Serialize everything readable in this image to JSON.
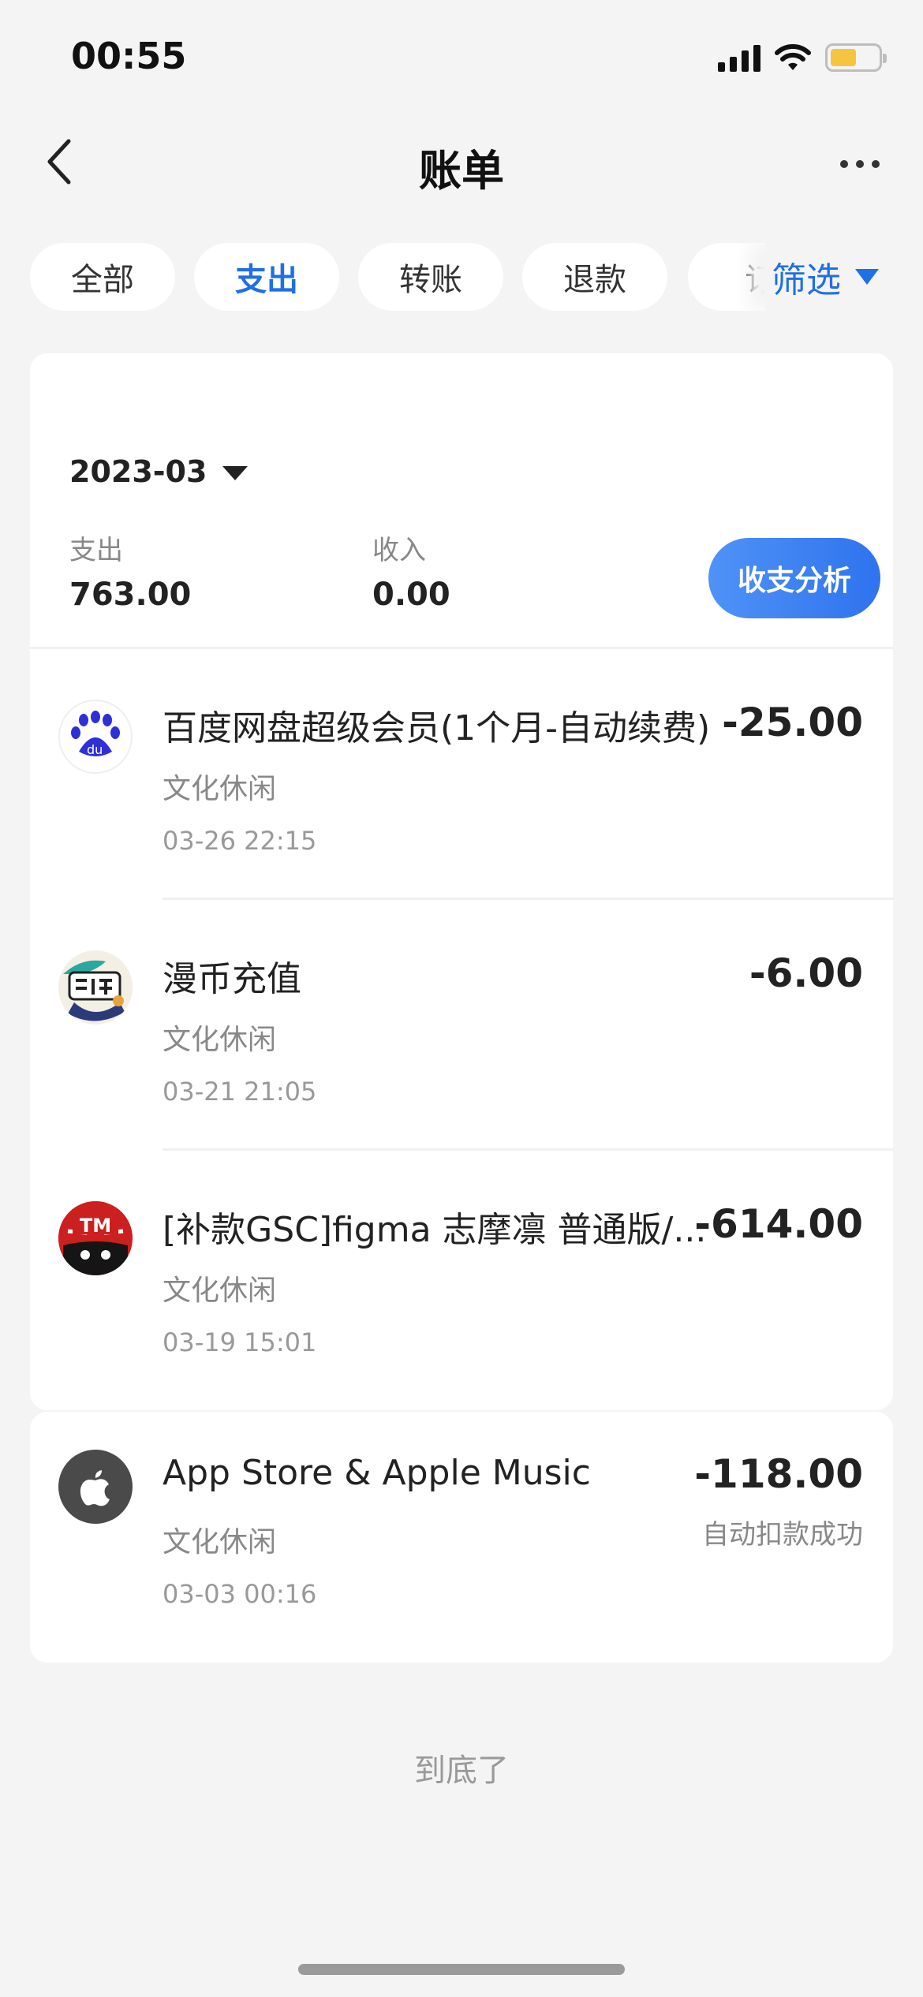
{
  "status_bar": {
    "time": "00:55"
  },
  "nav": {
    "title": "账单"
  },
  "tabs": [
    "全部",
    "支出",
    "转账",
    "退款",
    "订"
  ],
  "active_tab": 1,
  "filter": {
    "label": "筛选"
  },
  "summary": {
    "month": "2023-03",
    "expense_label": "支出",
    "expense_value": "763.00",
    "income_label": "收入",
    "income_value": "0.00",
    "analysis_button": "收支分析"
  },
  "transactions": [
    {
      "title": "百度网盘超级会员(1个月-自动续费)",
      "category": "文化休闲",
      "time": "03-26 22:15",
      "amount": "-25.00",
      "icon": "baidu-netdisk-logo"
    },
    {
      "title": "漫币充值",
      "category": "文化休闲",
      "time": "03-21 21:05",
      "amount": "-6.00",
      "icon": "manhua-logo"
    },
    {
      "title": "[补款GSC]figma 志摩凛 普通版/...",
      "category": "文化休闲",
      "time": "03-19 15:01",
      "amount": "-614.00",
      "icon": "tmall-logo"
    },
    {
      "title": "App Store & Apple Music",
      "category": "文化休闲",
      "time": "03-03 00:16",
      "amount": "-118.00",
      "status": "自动扣款成功",
      "icon": "apple-logo"
    }
  ],
  "footer": {
    "end_text": "到底了"
  },
  "colors": {
    "accent": "#1f6fe5",
    "background": "#f4f4f4"
  }
}
